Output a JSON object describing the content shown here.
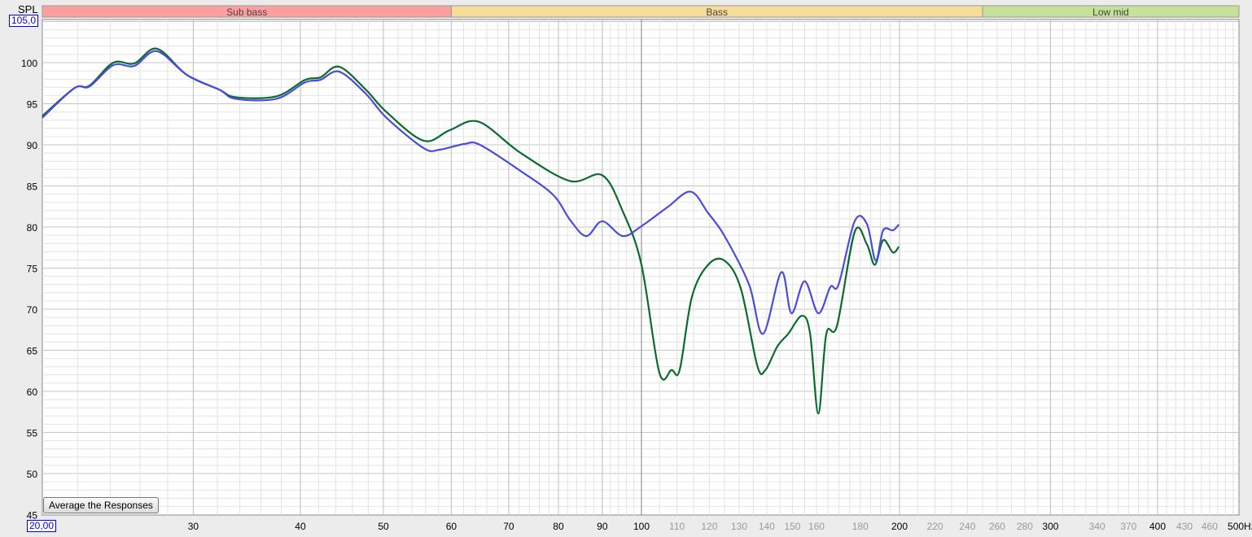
{
  "chart_data": {
    "type": "line",
    "ylabel": "SPL",
    "y_top_value": "105,0",
    "x_left_value": "20,00",
    "xscale": "log",
    "xlim": [
      20,
      500
    ],
    "ylim": [
      45,
      105
    ],
    "grid": true,
    "y_ticks": [
      100,
      95,
      90,
      85,
      80,
      75,
      70,
      65,
      60,
      55,
      50,
      45
    ],
    "x_ticks": [
      {
        "v": 30,
        "t": "30",
        "major": true
      },
      {
        "v": 40,
        "t": "40",
        "major": true
      },
      {
        "v": 50,
        "t": "50",
        "major": true
      },
      {
        "v": 60,
        "t": "60",
        "major": true
      },
      {
        "v": 70,
        "t": "70",
        "major": true
      },
      {
        "v": 80,
        "t": "80",
        "major": true
      },
      {
        "v": 90,
        "t": "90",
        "major": true
      },
      {
        "v": 100,
        "t": "100",
        "major": true
      },
      {
        "v": 110,
        "t": "110"
      },
      {
        "v": 120,
        "t": "120"
      },
      {
        "v": 130,
        "t": "130"
      },
      {
        "v": 140,
        "t": "140"
      },
      {
        "v": 150,
        "t": "150"
      },
      {
        "v": 160,
        "t": "160"
      },
      {
        "v": 180,
        "t": "180"
      },
      {
        "v": 200,
        "t": "200",
        "major": true
      },
      {
        "v": 220,
        "t": "220"
      },
      {
        "v": 240,
        "t": "240"
      },
      {
        "v": 260,
        "t": "260"
      },
      {
        "v": 280,
        "t": "280"
      },
      {
        "v": 300,
        "t": "300",
        "major": true
      },
      {
        "v": 340,
        "t": "340"
      },
      {
        "v": 370,
        "t": "370"
      },
      {
        "v": 400,
        "t": "400",
        "major": true
      },
      {
        "v": 430,
        "t": "430"
      },
      {
        "v": 460,
        "t": "460"
      },
      {
        "v": 500,
        "t": "500Hz",
        "major": true
      }
    ],
    "bands": [
      {
        "label": "Sub bass",
        "from": 20,
        "to": 60,
        "color": "#ff9e9e"
      },
      {
        "label": "Bass",
        "from": 60,
        "to": 250,
        "color": "#f7dd99"
      },
      {
        "label": "Low mid",
        "from": 250,
        "to": 500,
        "color": "#c6e29a"
      }
    ],
    "series": [
      {
        "name": "green",
        "color": "#0a6b2e",
        "x": [
          20,
          21.8,
          22.7,
          24.2,
          25.6,
          27.2,
          29.5,
          32.2,
          33.6,
          37.5,
          40.5,
          42.2,
          44.4,
          47.7,
          50.4,
          55.7,
          59.8,
          64.6,
          72.3,
          82.5,
          90,
          95.1,
          100,
          104.9,
          108.4,
          110.8,
          114.5,
          119.6,
          125,
          130.6,
          136.5,
          139.5,
          144.1,
          148.3,
          153.9,
          157.3,
          160.8,
          164.3,
          169.1,
          177.3,
          183.2,
          187.2,
          191.4,
          196.5,
          199.6
        ],
        "y": [
          93.5,
          96.9,
          97.2,
          100,
          99.9,
          101.7,
          98.5,
          96.7,
          95.8,
          95.9,
          97.9,
          98.2,
          99.5,
          96.7,
          94,
          90.5,
          91.8,
          92.8,
          89,
          85.6,
          86.3,
          81.9,
          75.4,
          62.3,
          62.6,
          62.6,
          71.5,
          75.4,
          75.9,
          72.5,
          63.1,
          62.6,
          65.5,
          67,
          69.2,
          67,
          57.3,
          67,
          68,
          79.4,
          77.9,
          75.4,
          78.4,
          76.9,
          77.6
        ]
      },
      {
        "name": "blue",
        "color": "#4b4bdc",
        "x": [
          20,
          21.8,
          22.7,
          24.2,
          25.6,
          27.2,
          29.5,
          32.2,
          33.6,
          37.5,
          40.5,
          42.2,
          44.4,
          47.7,
          50.4,
          55.7,
          58.1,
          62.1,
          64.8,
          72.3,
          78.9,
          82.5,
          86.2,
          90,
          95.1,
          100,
          107.2,
          114.1,
          119.6,
          125,
          133.5,
          138.6,
          145.6,
          149.6,
          155,
          160.8,
          166.1,
          169.8,
          177.3,
          183.2,
          187.6,
          191.4,
          196.5,
          199.6
        ],
        "y": [
          93.3,
          96.9,
          97.1,
          99.7,
          99.6,
          101.4,
          98.5,
          96.7,
          95.6,
          95.6,
          97.6,
          97.9,
          98.9,
          96.2,
          93.3,
          89.6,
          89.4,
          90.1,
          90,
          86.8,
          83.9,
          80.9,
          78.9,
          80.7,
          78.9,
          80.1,
          82.4,
          84.3,
          81.7,
          78.9,
          73,
          67,
          74.5,
          69.5,
          73.4,
          69.5,
          72.7,
          73,
          80.7,
          80.4,
          75.9,
          79.6,
          79.6,
          80.3
        ]
      }
    ]
  },
  "button": {
    "average": "Average the Responses"
  }
}
